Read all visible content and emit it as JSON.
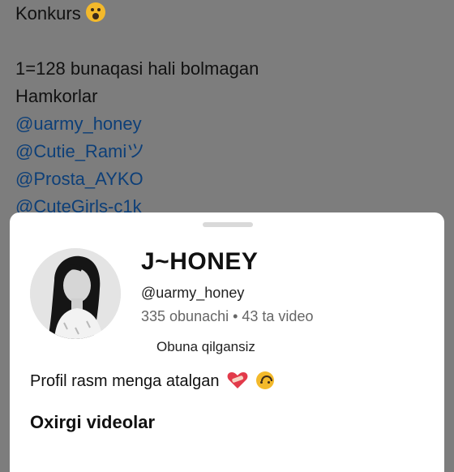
{
  "post": {
    "title": "Konkurs",
    "line1": "1=128 bunaqasi hali bolmagan",
    "line2": "Hamkorlar",
    "mentions": [
      "@uarmy_honey",
      "@Cutie_Ramiツ",
      "@Prosta_AYKO",
      "@CuteGirls-c1k"
    ]
  },
  "profile": {
    "name": "J~HONEY",
    "username": "@uarmy_honey",
    "stats": "335 obunachi • 43 ta video",
    "subscription_status": "Obuna qilgansiz",
    "bio": "Profil rasm menga atalgan",
    "section_title": "Oxirgi videolar"
  },
  "icons": {
    "title_emoji": "face-screaming-icon",
    "bio_emoji_1": "heart-bandaged-icon",
    "bio_emoji_2": "upside-down-face-icon"
  },
  "colors": {
    "backdrop": "#7d7d7d",
    "mention": "#0d3f78",
    "sheet": "#ffffff"
  }
}
